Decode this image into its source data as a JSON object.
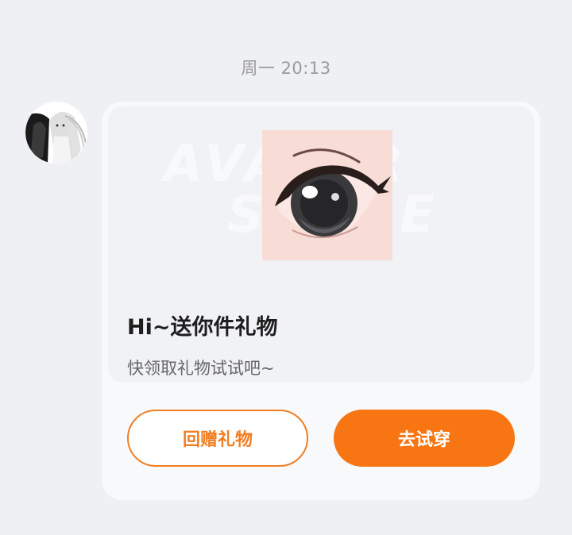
{
  "chat": {
    "timestamp": "周一 20:13"
  },
  "gift_card": {
    "banner": {
      "watermark_line1": "AVATAR",
      "watermark_line2": "STORE",
      "image_icon": "anime-eye-icon"
    },
    "title": "Hi~送你件礼物",
    "subtitle": "快领取礼物试试吧~",
    "buttons": {
      "return_gift": "回赠礼物",
      "try_on": "去试穿"
    }
  },
  "colors": {
    "background": "#eff0f4",
    "card": "#f8f9fb",
    "accent": "#f77512",
    "outline_accent": "#f07e23"
  }
}
